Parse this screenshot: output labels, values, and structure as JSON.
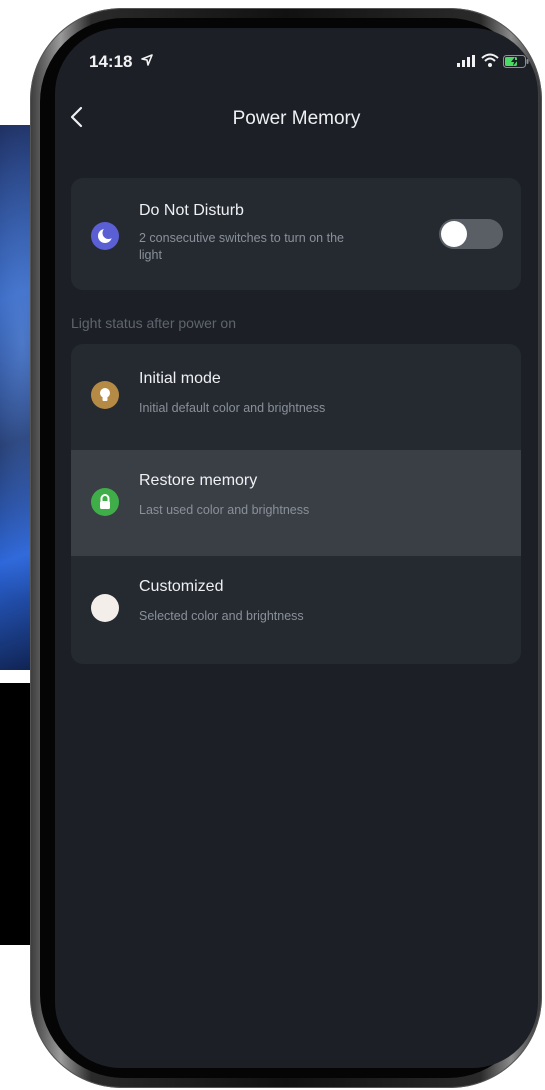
{
  "status_bar": {
    "time": "14:18"
  },
  "nav": {
    "title": "Power Memory"
  },
  "dnd": {
    "title": "Do Not Disturb",
    "subtitle_line1": "2 consecutive switches to turn on the",
    "subtitle_line2": "light",
    "enabled": false,
    "icon_color": "#5b5fd4"
  },
  "section_label": "Light status after power on",
  "modes": [
    {
      "title": "Initial mode",
      "subtitle": "Initial default color and brightness",
      "icon": "bulb-icon",
      "icon_color": "#b58a45",
      "selected": false
    },
    {
      "title": "Restore memory",
      "subtitle": "Last used color and brightness",
      "icon": "lock-icon",
      "icon_color": "#3fae49",
      "selected": true
    },
    {
      "title": "Customized",
      "subtitle": "Selected color and brightness",
      "icon": "color-dot-icon",
      "icon_color": "#f3eee9",
      "selected": false
    }
  ]
}
